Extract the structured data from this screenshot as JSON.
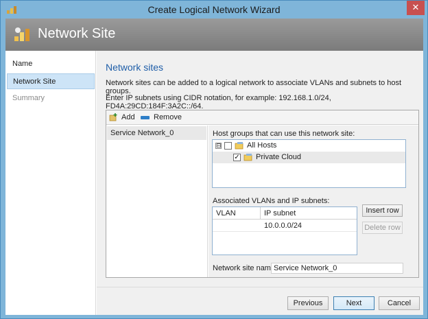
{
  "window": {
    "title": "Create Logical Network Wizard",
    "close_glyph": "✕"
  },
  "banner": {
    "title": "Network Site"
  },
  "nav": {
    "items": [
      {
        "label": "Name",
        "state": "normal"
      },
      {
        "label": "Network Site",
        "state": "active"
      },
      {
        "label": "Summary",
        "state": "disabled"
      }
    ]
  },
  "main": {
    "heading": "Network sites",
    "description": "Network sites can be added to a logical network to associate VLANs and subnets to host groups.",
    "cidr_hint": "Enter IP subnets using CIDR notation, for example: 192.168.1.0/24, FD4A:29CD:184F:3A2C::/64.",
    "toolbar": {
      "add_label": "Add",
      "remove_label": "Remove",
      "add_icon": "add-site-icon",
      "remove_icon": "remove-site-icon"
    },
    "sites": [
      {
        "label": "Service Network_0",
        "selected": true
      }
    ],
    "host_groups": {
      "label": "Host groups that can use this network site:",
      "items": [
        {
          "label": "All Hosts",
          "checked": false,
          "expander": "⊟",
          "icon": "host-group-icon"
        },
        {
          "label": "Private Cloud",
          "checked": true,
          "icon": "host-group-icon"
        }
      ]
    },
    "vlans": {
      "label": "Associated VLANs and IP subnets:",
      "columns": [
        "VLAN",
        "IP subnet"
      ],
      "rows": [
        {
          "vlan": "",
          "subnet": "10.0.0.0/24"
        }
      ],
      "insert_label": "Insert row",
      "delete_label": "Delete row"
    },
    "site_name": {
      "label": "Network site name:",
      "value": "Service Network_0"
    }
  },
  "footer": {
    "previous": "Previous",
    "next": "Next",
    "cancel": "Cancel"
  },
  "colors": {
    "accent": "#1f5ea8",
    "banner": "#8a8a8a",
    "titlebar": "#7fb5d9",
    "close": "#c75050",
    "remove_icon": "#2f7fc8"
  }
}
